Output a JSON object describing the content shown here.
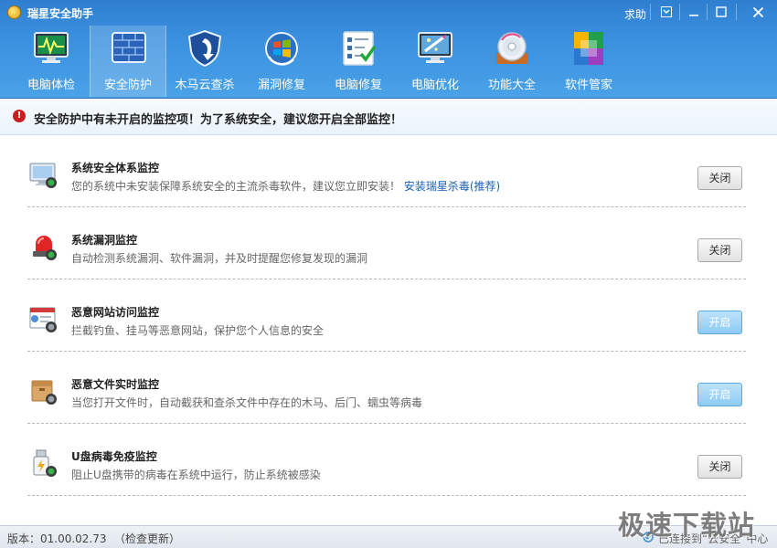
{
  "app": {
    "title": "瑞星安全助手"
  },
  "titlebar": {
    "help_label": "求助",
    "menu_icon": "menu-icon",
    "min_icon": "minimize-icon",
    "max_icon": "maximize-icon",
    "close_icon": "close-icon"
  },
  "nav": {
    "items": [
      {
        "label": "电脑体检",
        "icon": "monitor-checkup-icon"
      },
      {
        "label": "安全防护",
        "icon": "firewall-brick-icon",
        "active": true
      },
      {
        "label": "木马云查杀",
        "icon": "shield-arrow-icon"
      },
      {
        "label": "漏洞修复",
        "icon": "windows-update-icon"
      },
      {
        "label": "电脑修复",
        "icon": "checklist-icon"
      },
      {
        "label": "电脑优化",
        "icon": "optimize-brush-icon"
      },
      {
        "label": "功能大全",
        "icon": "disc-tools-icon"
      },
      {
        "label": "软件管家",
        "icon": "software-blocks-icon"
      }
    ]
  },
  "warning": {
    "text": "安全防护中有未开启的监控项！为了系统安全，建议您开启全部监控！"
  },
  "monitors": [
    {
      "title": "系统安全体系监控",
      "desc": "您的系统中未安装保障系统安全的主流杀毒软件，建议您立即安装！",
      "link": "安装瑞星杀毒(推荐)",
      "button": "关闭",
      "state": "off",
      "icon": "screen-monitor-icon"
    },
    {
      "title": "系统漏洞监控",
      "desc": "自动检测系统漏洞、软件漏洞，并及时提醒您修复发现的漏洞",
      "button": "关闭",
      "state": "off",
      "icon": "alarm-light-icon"
    },
    {
      "title": "恶意网站访问监控",
      "desc": "拦截钓鱼、挂马等恶意网站，保护您个人信息的安全",
      "button": "开启",
      "state": "on",
      "icon": "browser-window-icon"
    },
    {
      "title": "恶意文件实时监控",
      "desc": "当您打开文件时，自动截获和查杀文件中存在的木马、后门、蠕虫等病毒",
      "button": "开启",
      "state": "on",
      "icon": "file-box-icon"
    },
    {
      "title": "U盘病毒免疫监控",
      "desc": "阻止U盘携带的病毒在系统中运行，防止系统被感染",
      "button": "关闭",
      "state": "off",
      "icon": "usb-drive-icon"
    }
  ],
  "status": {
    "version": "版本：01.00.02.73",
    "update_link": "（检查更新）",
    "connection": "已连接到“云安全”中心"
  },
  "watermark": "极速下载站",
  "colors": {
    "header": "#3a90de",
    "button_on": "#8ccaf3",
    "warning_icon": "#c81e1e",
    "link": "#1a5fb4"
  }
}
